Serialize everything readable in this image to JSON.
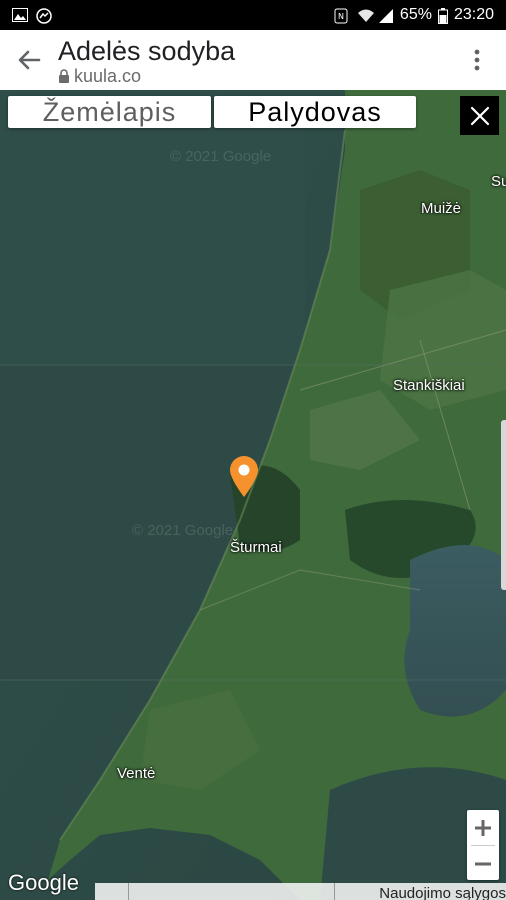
{
  "status_bar": {
    "battery": "65%",
    "time": "23:20",
    "icons": [
      "image-icon",
      "messenger-icon",
      "nfc-icon",
      "wifi-icon",
      "signal-icon",
      "battery-icon"
    ]
  },
  "app_bar": {
    "title": "Adelės sodyba",
    "url": "kuula.co",
    "icons": [
      "back-arrow-icon",
      "lock-icon",
      "more-vert-icon"
    ]
  },
  "map": {
    "type_map_label": "Žemėlapis",
    "type_satellite_label": "Palydovas",
    "close_icon": "close-icon",
    "watermark": "© 2021 Google",
    "places": {
      "muize": "Muižė",
      "su": "Su",
      "stankiskiai": "Stankiškiai",
      "sturmai": "Šturmai",
      "vente": "Ventė"
    },
    "marker_icon": "map-pin-icon",
    "zoom_in": "+",
    "zoom_out": "−",
    "google_logo": "Google",
    "footer_terms": "Naudojimo sąlygos",
    "colors": {
      "water": "#2f4a46",
      "land": "#3f6b3c",
      "marker": "#f5922e"
    }
  }
}
